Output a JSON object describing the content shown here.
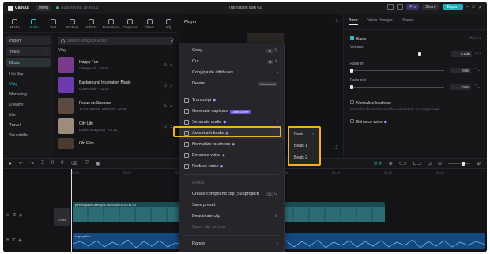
{
  "app": {
    "name": "CapCut",
    "menu_label": "Menu",
    "autosave": "Auto saved: 18:45:05",
    "project_title": "Translation task 02",
    "pro_label": "Pro",
    "share_label": "Share",
    "export_label": "Export"
  },
  "toolbar": {
    "tools": [
      {
        "label": "Media",
        "icon": "media-icon"
      },
      {
        "label": "Audio",
        "icon": "audio-icon"
      },
      {
        "label": "Text",
        "icon": "text-icon"
      },
      {
        "label": "Stickers",
        "icon": "stickers-icon"
      },
      {
        "label": "Effects",
        "icon": "effects-icon"
      },
      {
        "label": "Transitions",
        "icon": "transitions-icon"
      },
      {
        "label": "Captions",
        "icon": "captions-icon"
      },
      {
        "label": "Filters",
        "icon": "filters-icon"
      },
      {
        "label": "Adj.",
        "icon": "adjust-icon"
      }
    ],
    "active": "Audio"
  },
  "leftnav": {
    "items": [
      "Import",
      "Yours",
      "Music",
      "Hot Sign",
      "Vlog",
      "Marketing",
      "Dreamy",
      "title",
      "Travel",
      "Soundeffe..."
    ]
  },
  "music": {
    "search_placeholder": "Search songs or artists",
    "category": "Vlog",
    "tracks": [
      {
        "title": "Happy Fun",
        "artist": "Vintage Hit · 03:35",
        "color": "#7a3b8a"
      },
      {
        "title": "Background Inspiration Music",
        "artist": "Cusemsole · 01:40",
        "color": "#6c3bb0"
      },
      {
        "title": "Focus on Success",
        "artist": "ALEXANDAR ABRISO · 02:36",
        "color": "#5a4a40"
      },
      {
        "title": "City Life",
        "artist": "Daniel Bragonov · 02:11",
        "color": "#9c8c7c"
      },
      {
        "title": "Old Film",
        "artist": "",
        "color": "#4a3a30"
      }
    ]
  },
  "player": {
    "title": "Player"
  },
  "rightpanel": {
    "tabs": [
      "Basic",
      "Voice changer",
      "Speed"
    ],
    "basic_label": "Basic",
    "volume_label": "Volume",
    "volume_value": "0.0dB",
    "fadein_label": "Fade in",
    "fadein_value": "0.0s",
    "fadeout_label": "Fade out",
    "fadeout_value": "0.0s",
    "normalize_label": "Normalize loudness",
    "normalize_note": "Normalize the loudness of the selected clip to a target level.",
    "enhance_label": "Enhance voice"
  },
  "context_menu": {
    "items": [
      {
        "label": "Copy",
        "shortcut": "C",
        "type": "item"
      },
      {
        "label": "Cut",
        "shortcut": "X",
        "type": "item"
      },
      {
        "label": "Copy/paste attributes",
        "type": "arrow"
      },
      {
        "label": "Delete",
        "shortcut": "Backspace",
        "type": "item"
      },
      {
        "label": "Transcript",
        "type": "item",
        "pro": true
      },
      {
        "label": "Generate captions",
        "type": "item",
        "badge": "Limited-time"
      },
      {
        "label": "Separate audio",
        "type": "arrow",
        "pro": true
      },
      {
        "label": "Auto mark beats",
        "type": "arrow",
        "pro": true,
        "hilite": true
      },
      {
        "label": "Normalize loudness",
        "type": "item",
        "pro": true
      },
      {
        "label": "Enhance voice",
        "type": "arrow",
        "pro": true
      },
      {
        "label": "Reduce noise",
        "type": "item",
        "pro": true
      },
      {
        "label": "Group",
        "type": "disabled"
      },
      {
        "label": "Create compound clip (Subproject)",
        "shortcut": "G",
        "type": "item"
      },
      {
        "label": "Save preset",
        "type": "item"
      },
      {
        "label": "Deactivate clip",
        "shortcut": "V",
        "type": "item"
      },
      {
        "label": "Open clip section",
        "type": "disabled"
      },
      {
        "label": "Range",
        "type": "arrow"
      }
    ],
    "submenu": [
      "None",
      "Beats 1",
      "Beats 2"
    ]
  },
  "timeline": {
    "ruler": [
      "00:00",
      "00:02",
      "00:04",
      "00:06",
      "00:08",
      "00:10",
      "00:12",
      "00:14"
    ],
    "video_clip_label": "pexels-pavel-danilyuk-8459206  00:00:11:01",
    "audio_clip_label": "Happy Fun",
    "cover_label": "Cover"
  },
  "colors": {
    "accent": "#1fc4c9",
    "highlight": "#f0b21f",
    "pro": "#b69bff"
  }
}
